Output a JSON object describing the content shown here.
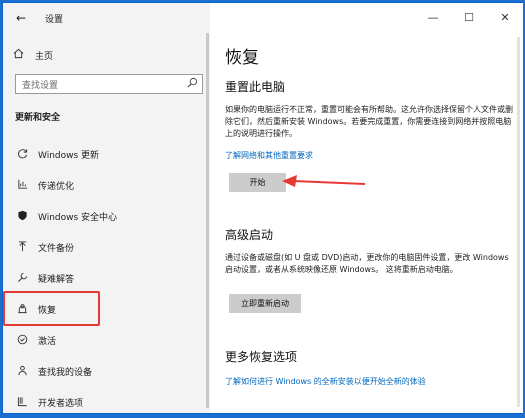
{
  "window": {
    "app_title": "设置",
    "controls": {
      "minimize": "—",
      "maximize": "☐",
      "close": "✕"
    }
  },
  "sidebar": {
    "back_icon": "←",
    "home": {
      "icon": "home-icon",
      "label": "主页"
    },
    "search": {
      "placeholder": "查找设置"
    },
    "section": "更新和安全",
    "items": [
      {
        "id": "windows-update",
        "icon": "refresh-icon",
        "label": "Windows 更新"
      },
      {
        "id": "delivery-optimization",
        "icon": "delivery-icon",
        "label": "传递优化"
      },
      {
        "id": "windows-security",
        "icon": "shield-icon",
        "label": "Windows 安全中心"
      },
      {
        "id": "backup",
        "icon": "upload-icon",
        "label": "文件备份"
      },
      {
        "id": "troubleshoot",
        "icon": "wrench-icon",
        "label": "疑难解答"
      },
      {
        "id": "recovery",
        "icon": "recovery-icon",
        "label": "恢复",
        "active": true
      },
      {
        "id": "activation",
        "icon": "check-circle-icon",
        "label": "激活"
      },
      {
        "id": "find-device",
        "icon": "person-pin-icon",
        "label": "查找我的设备"
      },
      {
        "id": "developers",
        "icon": "developer-icon",
        "label": "开发者选项"
      }
    ]
  },
  "main": {
    "title": "恢复",
    "reset": {
      "heading": "重置此电脑",
      "description": "如果你的电脑运行不正常，重置可能会有所帮助。这允许你选择保留个人文件或删除它们，然后重新安装 Windows。若要完成重置，你需要连接到网络并按照电脑上的说明进行操作。",
      "link": "了解网络和其他重置要求",
      "button": "开始"
    },
    "advanced": {
      "heading": "高级启动",
      "description": "通过设备或磁盘(如 U 盘或 DVD)启动，更改你的电脑固件设置，更改 Windows 启动设置，或者从系统映像还原 Windows。 这将重新启动电脑。",
      "button": "立即重新启动"
    },
    "more": {
      "heading": "更多恢复选项",
      "link": "了解如何进行 Windows 的全新安装以便开始全新的体验"
    }
  },
  "colors": {
    "accent": "#0067c0",
    "annotation": "#e53935",
    "desktop": "#1a6fd1"
  }
}
